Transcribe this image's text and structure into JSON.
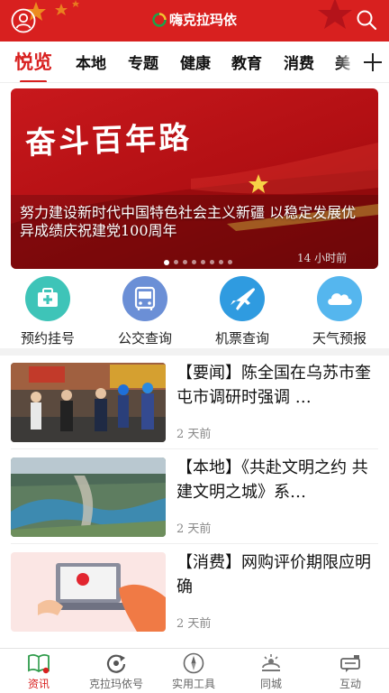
{
  "header": {
    "app_name": "嗨克拉玛依",
    "colors": {
      "brand": "#d8201f",
      "star": "#f2c230"
    },
    "icons": {
      "left": "user-icon",
      "right": "search-icon"
    }
  },
  "tabs": [
    {
      "label": "悦览",
      "active": true
    },
    {
      "label": "本地"
    },
    {
      "label": "专题"
    },
    {
      "label": "健康"
    },
    {
      "label": "教育"
    },
    {
      "label": "消费"
    },
    {
      "label": "美"
    }
  ],
  "tabs_more_icon": "plus-icon",
  "banner": {
    "headline": "奋斗百年路",
    "title": "努力建设新时代中国特色社会主义新疆 以稳定发展优异成绩庆祝建党100周年",
    "time": "14 小时前",
    "dots_total": 8,
    "dots_active": 0
  },
  "services": [
    {
      "label": "预约挂号",
      "icon": "medical-kit-icon",
      "color": "#3ec4b8"
    },
    {
      "label": "公交查询",
      "icon": "bus-icon",
      "color": "#6b8fd6"
    },
    {
      "label": "机票查询",
      "icon": "airplane-icon",
      "color": "#2f9be0"
    },
    {
      "label": "天气预报",
      "icon": "cloud-icon",
      "color": "#55b6ee"
    }
  ],
  "news": [
    {
      "title": "【要闻】陈全国在乌苏市奎屯市调研时强调 …",
      "time": "2 天前",
      "thumb": "officials-visit-factory-image"
    },
    {
      "title": "【本地】《共赴文明之约 共建文明之城》系…",
      "time": "2 天前",
      "thumb": "river-park-aerial-image"
    },
    {
      "title": "【消费】网购评价期限应明确",
      "time": "2 天前",
      "thumb": "online-shopping-laptop-image"
    }
  ],
  "bottom_nav": [
    {
      "label": "资讯",
      "icon": "book-icon",
      "active": true
    },
    {
      "label": "克拉玛依号",
      "icon": "refresh-icon"
    },
    {
      "label": "实用工具",
      "icon": "compass-icon"
    },
    {
      "label": "同城",
      "icon": "location-icon"
    },
    {
      "label": "互动",
      "icon": "chat-icon"
    }
  ]
}
